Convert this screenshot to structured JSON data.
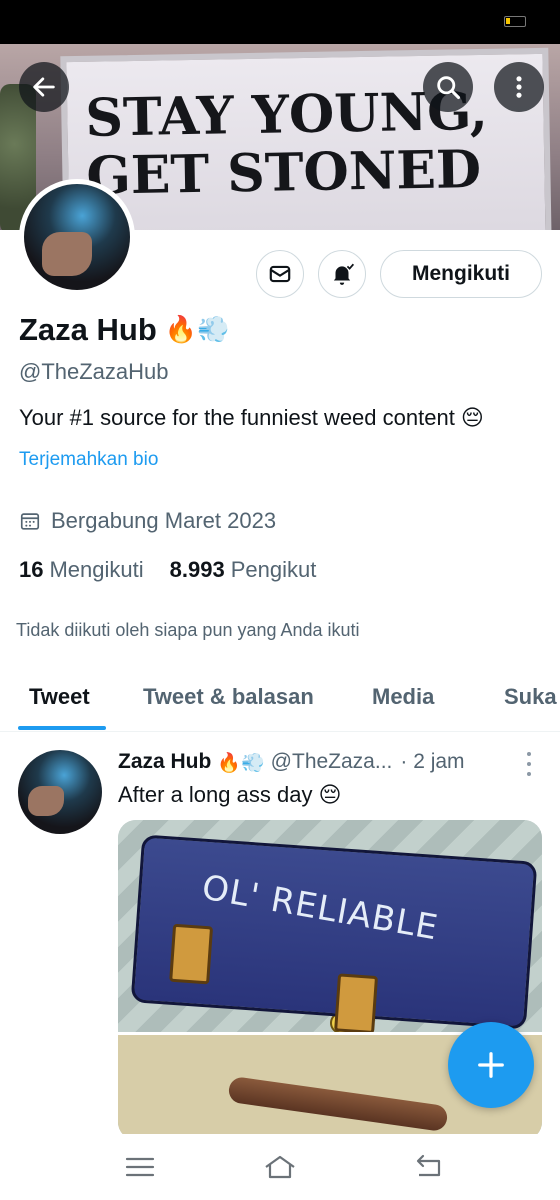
{
  "banner": {
    "sign_line1": "STAY YOUNG,",
    "sign_line2": "GET STONED"
  },
  "profile": {
    "name": "Zaza Hub",
    "name_emojis": "🔥💨",
    "handle": "@TheZazaHub",
    "bio": "Your #1 source for the funniest weed content 😔",
    "translate_label": "Terjemahkan bio",
    "joined": "Bergabung Maret 2023",
    "following_count": "16",
    "following_label": "Mengikuti",
    "followers_count": "8.993",
    "followers_label": "Pengikut",
    "not_followed_text": "Tidak diikuti oleh siapa pun yang Anda ikuti",
    "follow_button_label": "Mengikuti"
  },
  "tabs": [
    {
      "label": "Tweet",
      "active": true
    },
    {
      "label": "Tweet & balasan",
      "active": false
    },
    {
      "label": "Media",
      "active": false
    },
    {
      "label": "Suka",
      "active": false
    }
  ],
  "tweet": {
    "author": "Zaza Hub",
    "author_emojis": "🔥💨",
    "handle": "@TheZaza...",
    "time": "· 2 jam",
    "text": "After a long ass day 😔",
    "media_text": "OL' RELIABLE"
  },
  "icons": {
    "back": "back-arrow-icon",
    "search": "search-icon",
    "more": "more-vertical-icon",
    "message": "envelope-icon",
    "notify": "bell-icon",
    "calendar": "calendar-icon",
    "compose": "plus-icon"
  },
  "colors": {
    "accent": "#1d9bf0",
    "text_primary": "#0f1419",
    "text_secondary": "#536471"
  }
}
